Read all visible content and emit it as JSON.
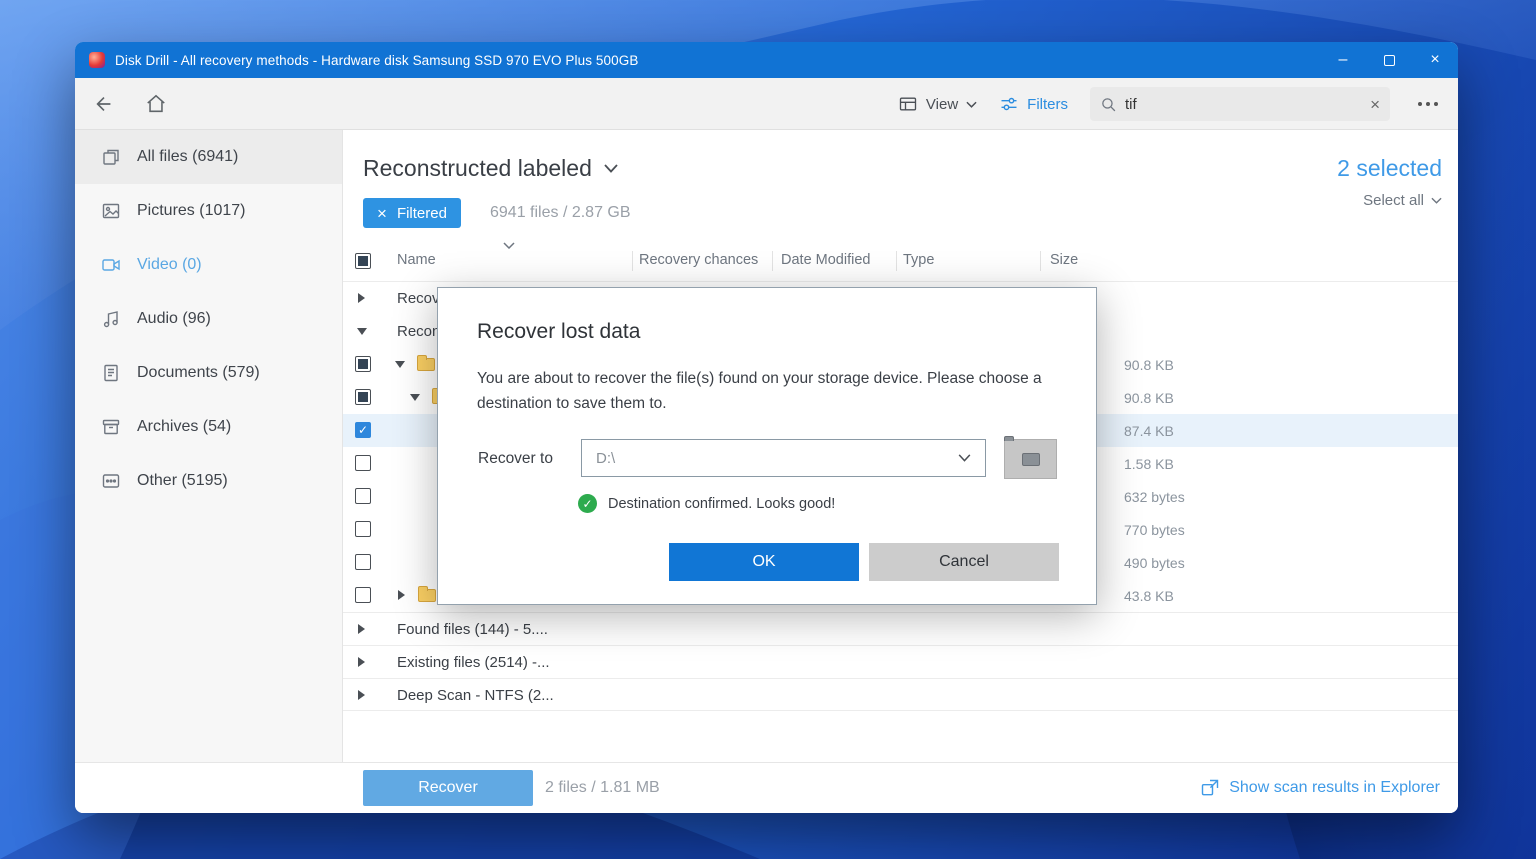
{
  "window": {
    "title": "Disk Drill - All recovery methods - Hardware disk Samsung SSD 970 EVO Plus 500GB"
  },
  "toolbar": {
    "view_label": "View",
    "filters_label": "Filters",
    "search_value": "tif"
  },
  "sidebar": {
    "items": [
      {
        "label": "All files (6941)"
      },
      {
        "label": "Pictures (1017)"
      },
      {
        "label": "Video (0)"
      },
      {
        "label": "Audio (96)"
      },
      {
        "label": "Documents (579)"
      },
      {
        "label": "Archives (54)"
      },
      {
        "label": "Other (5195)"
      }
    ]
  },
  "content": {
    "heading": "Reconstructed labeled",
    "selected": "2 selected",
    "select_all": "Select all",
    "filtered": "Filtered",
    "summary": "6941 files / 2.87 GB",
    "columns": [
      "Name",
      "Recovery chances",
      "Date Modified",
      "Type",
      "Size"
    ],
    "rows": [
      {
        "name": "Recov"
      },
      {
        "name": "Recon"
      },
      {
        "size": "90.8 KB"
      },
      {
        "size": "90.8 KB"
      },
      {
        "size": "87.4 KB"
      },
      {
        "size": "1.58 KB"
      },
      {
        "size": "632 bytes"
      },
      {
        "size": "770 bytes"
      },
      {
        "size": "490 bytes"
      },
      {
        "size": "43.8 KB"
      }
    ],
    "groups": [
      "Found files (144) - 5....",
      "Existing files (2514) -...",
      "Deep Scan - NTFS (2..."
    ]
  },
  "dialog": {
    "title": "Recover lost data",
    "message": "You are about to recover the file(s) found on your storage device. Please choose a destination to save them to.",
    "recover_to_label": "Recover to",
    "destination": "D:\\",
    "confirmation": "Destination confirmed. Looks good!",
    "ok_label": "OK",
    "cancel_label": "Cancel"
  },
  "footer": {
    "recover_label": "Recover",
    "selection_summary": "2 files / 1.81 MB",
    "explorer_link": "Show scan results in Explorer"
  },
  "icons": {
    "clear_glyph": "×",
    "close_glyph": "×",
    "minimize_glyph": "–",
    "check_glyph": "✓",
    "names": [
      "app-logo-icon",
      "minimize-icon",
      "maximize-icon",
      "close-icon",
      "back-arrow-icon",
      "home-icon",
      "view-icon",
      "filters-icon",
      "search-icon",
      "clear-icon",
      "more-icon",
      "all-files-icon",
      "pictures-icon",
      "video-icon",
      "audio-icon",
      "documents-icon",
      "archives-icon",
      "other-icon",
      "sort-chevron-icon",
      "expand-arrow-icon",
      "folder-icon",
      "dropdown-chevron-icon",
      "browse-folder-icon",
      "success-check-icon",
      "explorer-icon",
      "chevron-down-icon"
    ]
  },
  "colors": {
    "titlebar": "#1173d4",
    "accent": "#1176d5",
    "link_blue": "#3f9ae7",
    "chip_blue": "#2e93e2",
    "row_highlight": "#e8f2fb",
    "success_green": "#2dab4e"
  }
}
